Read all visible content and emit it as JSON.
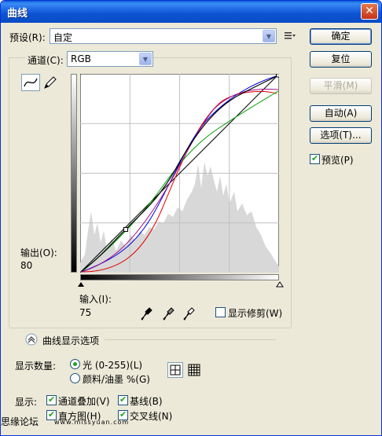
{
  "window": {
    "title": "曲线",
    "close_glyph": "✕"
  },
  "preset": {
    "label": "预设(R):",
    "value": "自定"
  },
  "channel": {
    "label": "通道(C):",
    "value": "RGB"
  },
  "buttons": {
    "ok": "确定",
    "reset": "复位",
    "smooth": "平滑(M)",
    "auto": "自动(A)",
    "options": "选项(T)..."
  },
  "preview": {
    "label": "预览(P)",
    "checked": true
  },
  "output": {
    "label": "输出(O):",
    "value": "80"
  },
  "input": {
    "label": "输入(I):",
    "value": "75"
  },
  "show_clipping": {
    "label": "显示修剪(W)",
    "checked": false
  },
  "curve_display_options": {
    "title": "曲线显示选项"
  },
  "show_amount": {
    "label": "显示数量:",
    "light": "光 (0-255)(L)",
    "pigment": "颜料/油墨 %(G)",
    "selected": "light"
  },
  "show": {
    "label": "显示:",
    "channel_overlays": "通道叠加(V)",
    "baseline": "基线(B)",
    "histogram": "直方图(H)",
    "intersection_line": "交叉线(N)"
  },
  "watermark": {
    "left": "思缘论坛",
    "right": "www.missyuan.com"
  },
  "curves": {
    "composite": "#000000",
    "red": "#e00000",
    "green": "#00a000",
    "blue": "#0000e0",
    "magenta": "#a0108a"
  },
  "icons": [
    "curve-tool-icon",
    "pencil-icon",
    "preset-menu-icon",
    "black-eyedropper-icon",
    "gray-eyedropper-icon",
    "white-eyedropper-icon",
    "collapse-icon",
    "simple-grid-icon",
    "detailed-grid-icon"
  ]
}
